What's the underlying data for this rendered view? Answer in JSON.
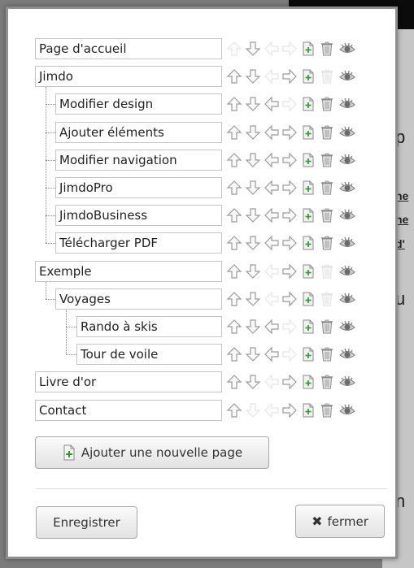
{
  "pages": [
    {
      "label": "Page d'accueil",
      "depth": 0,
      "up": false,
      "down": true,
      "left": false,
      "right": false,
      "trash": true
    },
    {
      "label": "Jimdo",
      "depth": 0,
      "up": true,
      "down": true,
      "left": false,
      "right": true,
      "trash": false
    },
    {
      "label": "Modifier design",
      "depth": 1,
      "up": true,
      "down": true,
      "left": true,
      "right": false,
      "trash": true
    },
    {
      "label": "Ajouter éléments",
      "depth": 1,
      "up": true,
      "down": true,
      "left": true,
      "right": true,
      "trash": true
    },
    {
      "label": "Modifier navigation",
      "depth": 1,
      "up": true,
      "down": true,
      "left": true,
      "right": true,
      "trash": true
    },
    {
      "label": "JimdoPro",
      "depth": 1,
      "up": true,
      "down": true,
      "left": true,
      "right": true,
      "trash": true
    },
    {
      "label": "JimdoBusiness",
      "depth": 1,
      "up": true,
      "down": true,
      "left": true,
      "right": true,
      "trash": true
    },
    {
      "label": "Télécharger PDF",
      "depth": 1,
      "up": true,
      "down": true,
      "left": true,
      "right": true,
      "trash": true
    },
    {
      "label": "Exemple",
      "depth": 0,
      "up": true,
      "down": true,
      "left": false,
      "right": true,
      "trash": false
    },
    {
      "label": "Voyages",
      "depth": 1,
      "up": true,
      "down": true,
      "left": false,
      "right": true,
      "trash": false
    },
    {
      "label": "Rando à skis",
      "depth": 2,
      "up": true,
      "down": true,
      "left": true,
      "right": false,
      "trash": true
    },
    {
      "label": "Tour de voile",
      "depth": 2,
      "up": true,
      "down": true,
      "left": true,
      "right": false,
      "trash": true
    },
    {
      "label": "Livre d'or",
      "depth": 0,
      "up": true,
      "down": true,
      "left": false,
      "right": true,
      "trash": true
    },
    {
      "label": "Contact",
      "depth": 0,
      "up": true,
      "down": false,
      "left": false,
      "right": true,
      "trash": true
    }
  ],
  "add_page_label": "Ajouter une nouvelle page",
  "save_label": "Enregistrer",
  "close_label": "fermer",
  "background_fragments": [
    "p",
    "ne",
    "ne",
    "d'",
    "u",
    "n"
  ],
  "icons": [
    "arrow-up-icon",
    "arrow-down-icon",
    "arrow-left-icon",
    "arrow-right-icon",
    "add-subpage-icon",
    "trash-icon",
    "visibility-eye-icon"
  ]
}
